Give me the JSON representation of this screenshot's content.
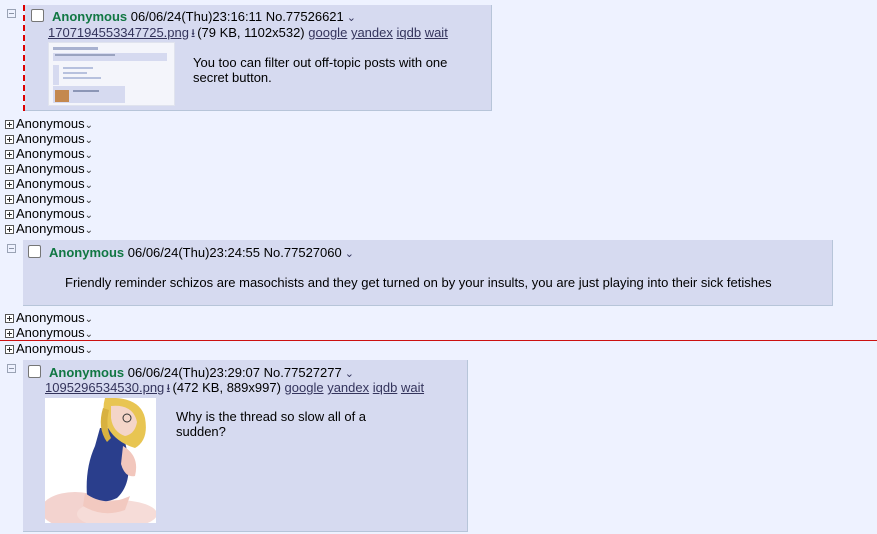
{
  "posts": [
    {
      "name": "Anonymous",
      "datetime": "06/06/24(Thu)23:16:11",
      "number": "No.77526621",
      "file_name": "1707194553347725.png",
      "file_info": "(79 KB, 1102x532)",
      "search_links": [
        "google",
        "yandex",
        "iqdb",
        "wait"
      ],
      "message": "You too can filter out off-topic posts with one secret button."
    },
    {
      "name": "Anonymous",
      "datetime": "06/06/24(Thu)23:24:55",
      "number": "No.77527060",
      "message": "Friendly reminder schizos are masochists and they get turned on by your insults, you are just playing into their sick fetishes"
    },
    {
      "name": "Anonymous",
      "datetime": "06/06/24(Thu)23:29:07",
      "number": "No.77527277",
      "file_name": "1095296534530.png",
      "file_info": "(472 KB, 889x997)",
      "search_links": [
        "google",
        "yandex",
        "iqdb",
        "wait"
      ],
      "message": "Why is the thread so slow all of a sudden?"
    }
  ],
  "hidden_posts_label": "Anonymous",
  "icons": {
    "download": "download-icon",
    "menu": "chevron-down-icon",
    "collapse": "minus-toggle-icon",
    "expand": "plus-toggle-icon"
  },
  "colors": {
    "background": "#eef2ff",
    "reply_bg": "#d6daf0",
    "name": "#117743",
    "link": "#34345c",
    "highlight_border": "#dd0000",
    "separator": "#cc1111"
  }
}
